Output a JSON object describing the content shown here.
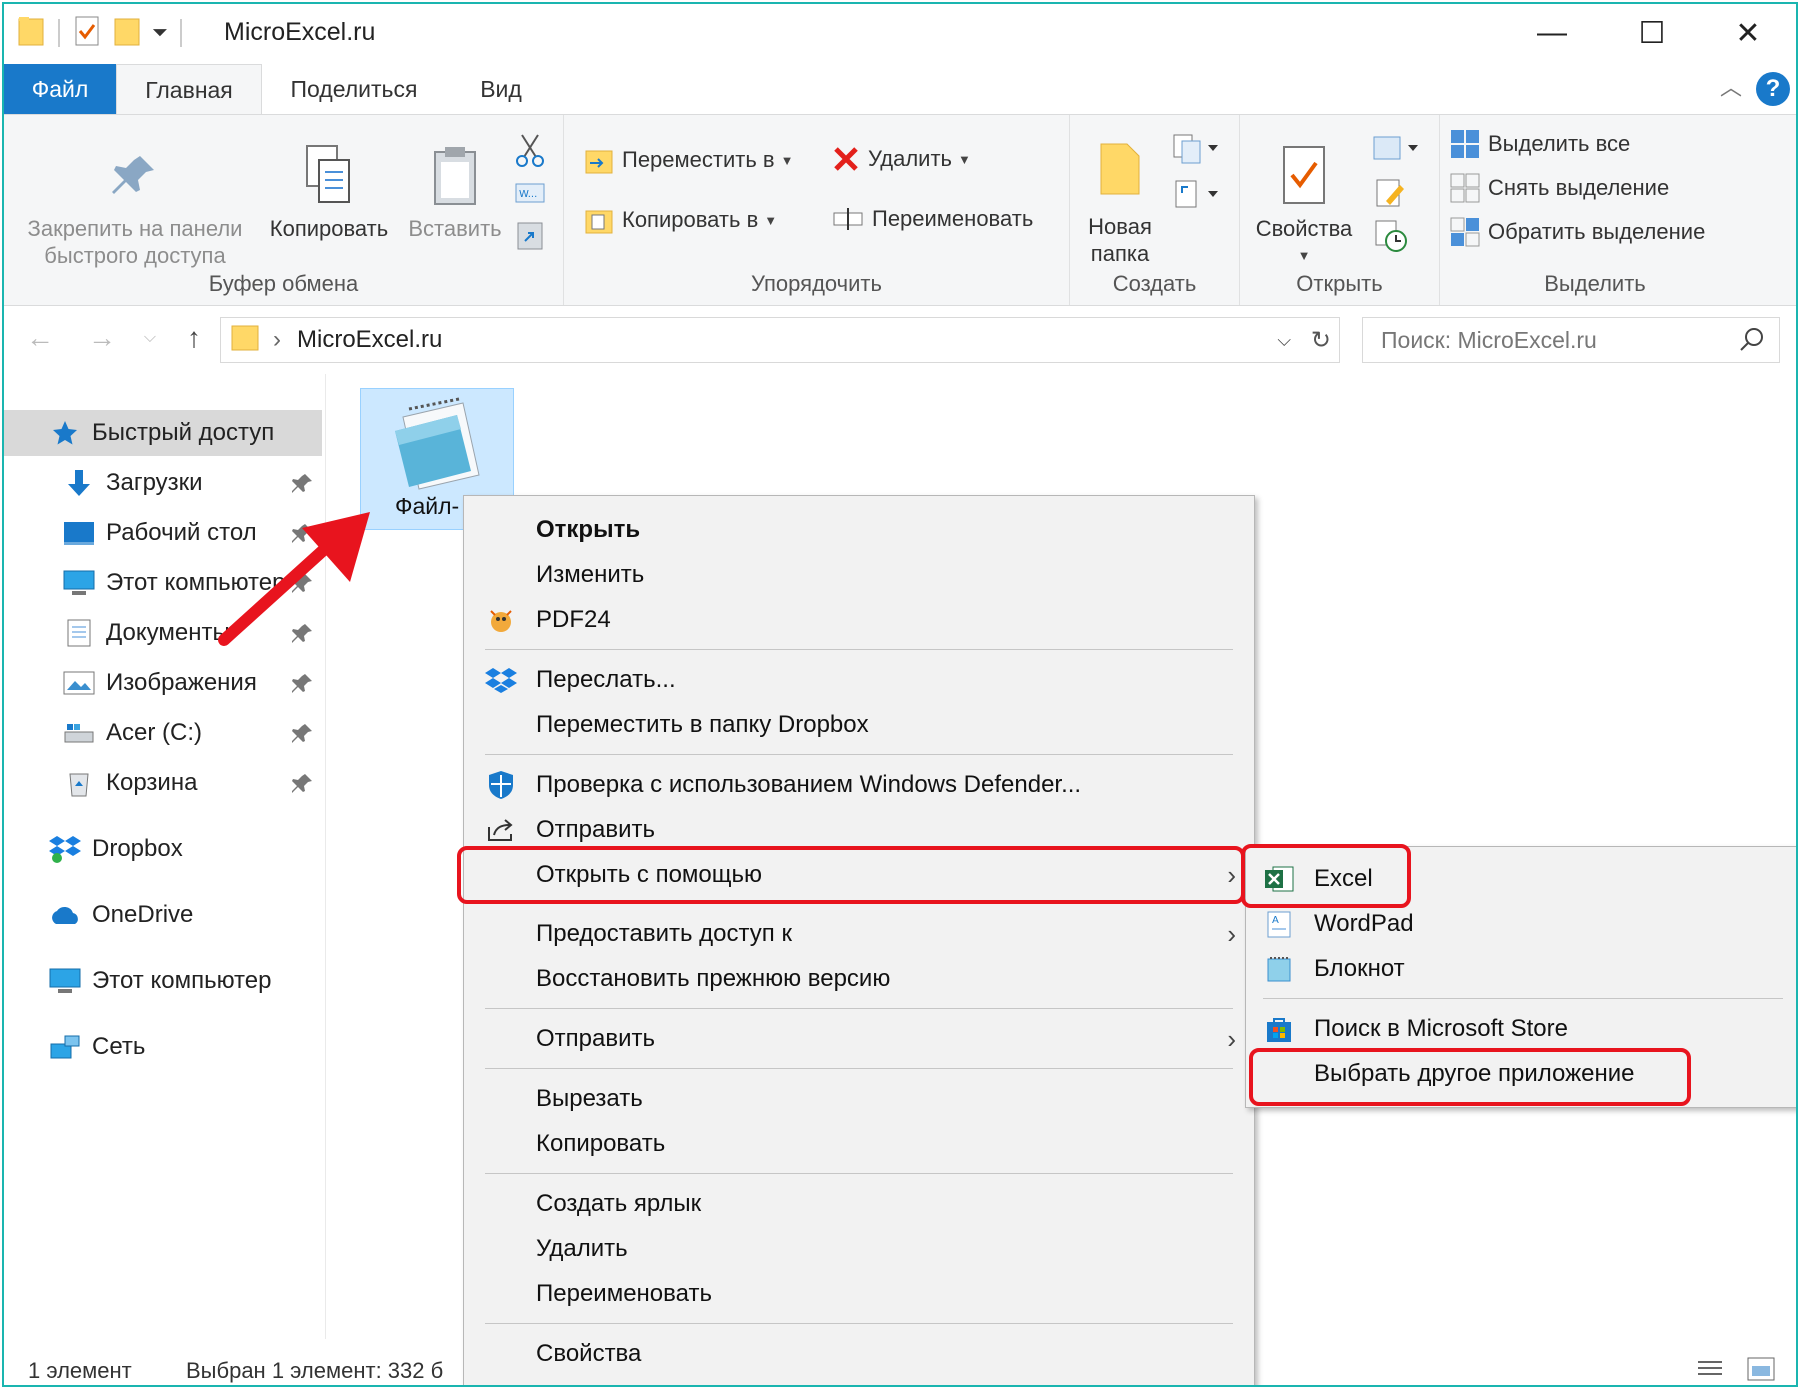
{
  "window": {
    "title": "MicroExcel.ru",
    "minimize": "—",
    "maximize": "☐",
    "close": "✕"
  },
  "ribbon_tabs": [
    {
      "label": "Файл"
    },
    {
      "label": "Главная"
    },
    {
      "label": "Поделиться"
    },
    {
      "label": "Вид"
    }
  ],
  "help_label": "?",
  "ribbon": {
    "clipboard": {
      "pin_label_1": "Закрепить на панели",
      "pin_label_2": "быстрого доступа",
      "copy": "Копировать",
      "paste": "Вставить",
      "group": "Буфер обмена"
    },
    "organize": {
      "move_to": "Переместить в",
      "copy_to": "Копировать в",
      "delete": "Удалить",
      "rename": "Переименовать",
      "group": "Упорядочить"
    },
    "new": {
      "new_folder_1": "Новая",
      "new_folder_2": "папка",
      "group": "Создать"
    },
    "open": {
      "properties": "Свойства",
      "group": "Открыть"
    },
    "select": {
      "select_all": "Выделить все",
      "select_none": "Снять выделение",
      "invert": "Обратить выделение",
      "group": "Выделить"
    }
  },
  "address": {
    "path": "MicroExcel.ru",
    "search_placeholder": "Поиск: MicroExcel.ru"
  },
  "nav_pane": {
    "quick_access": "Быстрый доступ",
    "items": [
      {
        "label": "Загрузки",
        "icon": "download-icon"
      },
      {
        "label": "Рабочий стол",
        "icon": "desktop-icon"
      },
      {
        "label": "Этот компьютер",
        "icon": "computer-icon"
      },
      {
        "label": "Документы",
        "icon": "documents-icon"
      },
      {
        "label": "Изображения",
        "icon": "images-icon"
      },
      {
        "label": "Acer (C:)",
        "icon": "drive-icon"
      },
      {
        "label": "Корзина",
        "icon": "recycle-bin-icon"
      }
    ],
    "roots": [
      {
        "label": "Dropbox",
        "icon": "dropbox-icon"
      },
      {
        "label": "OneDrive",
        "icon": "onedrive-icon"
      },
      {
        "label": "Этот компьютер",
        "icon": "computer-icon"
      },
      {
        "label": "Сеть",
        "icon": "network-icon"
      }
    ]
  },
  "file": {
    "name": "Файл-"
  },
  "context_menu": {
    "open": "Открыть",
    "edit": "Изменить",
    "pdf24": "PDF24",
    "send_dropbox": "Переслать...",
    "move_dropbox": "Переместить в папку Dropbox",
    "defender": "Проверка с использованием Windows Defender...",
    "share": "Отправить",
    "open_with": "Открыть с помощью",
    "give_access": "Предоставить доступ к",
    "restore": "Восстановить прежнюю версию",
    "send_to": "Отправить",
    "cut": "Вырезать",
    "copy": "Копировать",
    "shortcut": "Создать ярлык",
    "delete": "Удалить",
    "rename": "Переименовать",
    "properties": "Свойства"
  },
  "open_with_menu": {
    "excel": "Excel",
    "wordpad": "WordPad",
    "notepad": "Блокнот",
    "store": "Поиск в Microsoft Store",
    "other": "Выбрать другое приложение"
  },
  "status": {
    "count": "1 элемент",
    "selected": "Выбран 1 элемент: 332 б"
  },
  "colors": {
    "accent": "#1979ca",
    "highlight": "#e8141e",
    "selection": "#cce8ff"
  }
}
